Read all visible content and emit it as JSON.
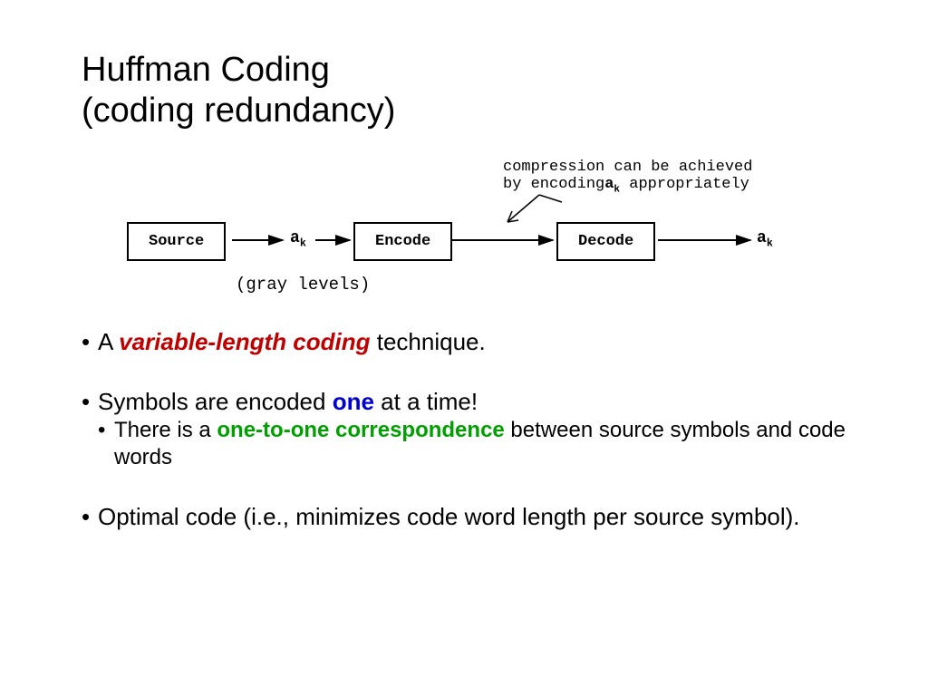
{
  "title_line1": "Huffman Coding",
  "title_line2": "(coding redundancy)",
  "diagram": {
    "source": "Source",
    "encode": "Encode",
    "decode": "Decode",
    "a": "a",
    "k": "k",
    "gray_levels": "(gray levels)",
    "annot_line1": "compression can be achieved",
    "annot_line2_a": "by encoding",
    "annot_line2_b": " appropriately"
  },
  "bullets": {
    "b1_a": "A ",
    "b1_em": "variable-length coding",
    "b1_b": " technique.",
    "b2_a": "Symbols are encoded ",
    "b2_em": "one",
    "b2_b": " at a time!",
    "b2s_a": "There is a ",
    "b2s_em": "one-to-one correspondence",
    "b2s_b": " between source symbols and code words",
    "b3": "Optimal code (i.e., minimizes code word length per source symbol)."
  }
}
